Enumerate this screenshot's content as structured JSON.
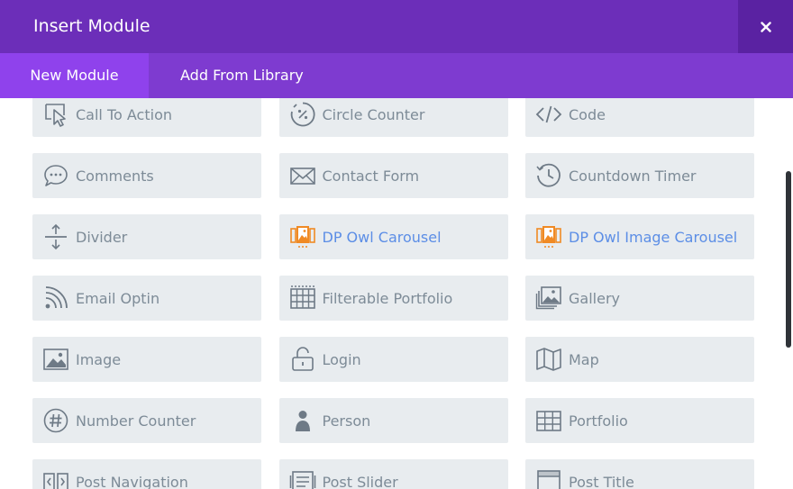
{
  "header": {
    "title": "Insert Module",
    "close_icon": "close-icon"
  },
  "tabs": [
    {
      "label": "New Module",
      "active": true
    },
    {
      "label": "Add From Library",
      "active": false
    }
  ],
  "colors": {
    "header_bg": "#6c2eb9",
    "tabs_bg": "#7e3bd0",
    "active_tab_bg": "#8f42ec",
    "module_bg": "#e8ecef",
    "module_text": "#7d8b97",
    "custom_module_text": "#5c8ee6",
    "custom_icon": "#f08a24"
  },
  "modules": [
    {
      "label": "Call To Action",
      "icon": "cursor-click-icon"
    },
    {
      "label": "Circle Counter",
      "icon": "circle-percent-icon"
    },
    {
      "label": "Code",
      "icon": "code-icon"
    },
    {
      "label": "Comments",
      "icon": "speech-bubble-icon"
    },
    {
      "label": "Contact Form",
      "icon": "envelope-icon"
    },
    {
      "label": "Countdown Timer",
      "icon": "clock-icon"
    },
    {
      "label": "Divider",
      "icon": "divider-icon"
    },
    {
      "label": "DP Owl Carousel",
      "icon": "carousel-icon",
      "custom": true
    },
    {
      "label": "DP Owl Image Carousel",
      "icon": "carousel-icon",
      "custom": true
    },
    {
      "label": "Email Optin",
      "icon": "rss-icon"
    },
    {
      "label": "Filterable Portfolio",
      "icon": "grid-table-icon"
    },
    {
      "label": "Gallery",
      "icon": "gallery-icon"
    },
    {
      "label": "Image",
      "icon": "image-icon"
    },
    {
      "label": "Login",
      "icon": "lock-icon"
    },
    {
      "label": "Map",
      "icon": "map-icon"
    },
    {
      "label": "Number Counter",
      "icon": "hash-icon"
    },
    {
      "label": "Person",
      "icon": "person-icon"
    },
    {
      "label": "Portfolio",
      "icon": "portfolio-grid-icon"
    },
    {
      "label": "Post Navigation",
      "icon": "post-navigation-icon"
    },
    {
      "label": "Post Slider",
      "icon": "post-slider-icon"
    },
    {
      "label": "Post Title",
      "icon": "post-title-icon"
    }
  ]
}
